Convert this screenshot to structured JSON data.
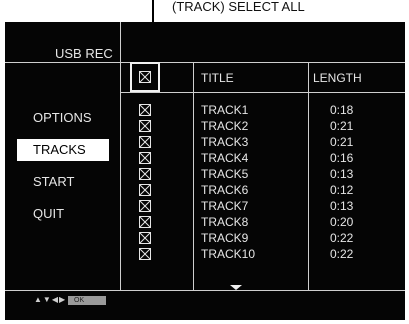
{
  "callout": {
    "text": "(TRACK) SELECT ALL"
  },
  "screen": {
    "title": "USB REC",
    "menu": [
      {
        "label": "OPTIONS",
        "selected": false
      },
      {
        "label": "TRACKS",
        "selected": true
      },
      {
        "label": "START",
        "selected": false
      },
      {
        "label": "QUIT",
        "selected": false
      }
    ],
    "columns": {
      "title": "TITLE",
      "length": "LENGTH"
    },
    "tracks": [
      {
        "title": "TRACK1",
        "length": "0:18",
        "checked": true
      },
      {
        "title": "TRACK2",
        "length": "0:21",
        "checked": true
      },
      {
        "title": "TRACK3",
        "length": "0:21",
        "checked": true
      },
      {
        "title": "TRACK4",
        "length": "0:16",
        "checked": true
      },
      {
        "title": "TRACK5",
        "length": "0:13",
        "checked": true
      },
      {
        "title": "TRACK6",
        "length": "0:12",
        "checked": true
      },
      {
        "title": "TRACK7",
        "length": "0:13",
        "checked": true
      },
      {
        "title": "TRACK8",
        "length": "0:20",
        "checked": true
      },
      {
        "title": "TRACK9",
        "length": "0:22",
        "checked": true
      },
      {
        "title": "TRACK10",
        "length": "0:22",
        "checked": true
      }
    ],
    "footer": {
      "nav_icon": "arrow-keys-icon",
      "nav_glyphs": "▲▼◀▶",
      "ok_label": "OK"
    }
  },
  "colors": {
    "screen_bg": "#050505",
    "text": "#e6e6e6",
    "divider": "#cfcfcf",
    "highlight": "#ffffff"
  }
}
